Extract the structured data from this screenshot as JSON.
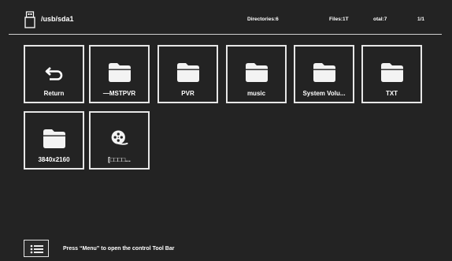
{
  "header": {
    "path": "/usb/sda1",
    "directories": "Directories:6",
    "files": "Files:1T",
    "total": "otal:7",
    "page": "1/1"
  },
  "items": [
    {
      "label": "Return",
      "icon": "return-icon"
    },
    {
      "label": "—MSTPVR",
      "icon": "folder-icon"
    },
    {
      "label": "PVR",
      "icon": "folder-icon"
    },
    {
      "label": "music",
      "icon": "folder-icon"
    },
    {
      "label": "System Volu...",
      "icon": "folder-icon"
    },
    {
      "label": "TXT",
      "icon": "folder-icon"
    },
    {
      "label": "3840x2160",
      "icon": "folder-icon"
    },
    {
      "label": "[□□□□...",
      "icon": "film-reel-icon"
    }
  ],
  "footer": {
    "hint": "Press “Menu” to open the control Tool Bar"
  }
}
